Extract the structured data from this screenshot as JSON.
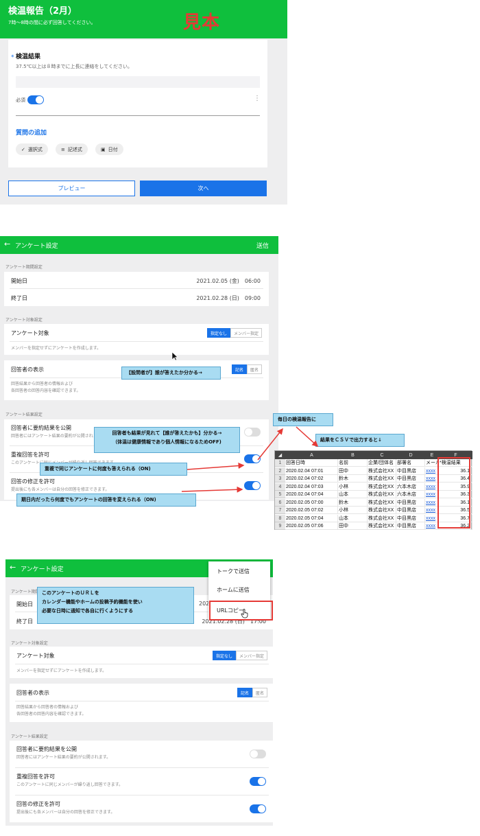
{
  "screen1": {
    "title": "検温報告（2月）",
    "subtitle": "7時～8時の間に必ず回答してください。",
    "sample_stamp": "見本",
    "question_required_mark": "*",
    "question_title": "検温結果",
    "question_desc": "37.5℃以上は８時までに上長に連絡をしてください。",
    "required_label": "必須",
    "more_icon": "⋮",
    "add_question": "質問の追加",
    "chips": [
      "選択式",
      "記述式",
      "日付"
    ],
    "preview_button": "プレビュー",
    "next_button": "次へ"
  },
  "screen2": {
    "title": "アンケート設定",
    "send": "送信",
    "period_section": "アンケート期間設定",
    "start_label": "開始日",
    "start_value": "2021.02.05 (金)　06:00",
    "end_label": "終了日",
    "end_value": "2021.02.28 (日)　09:00",
    "target_section": "アンケート対象設定",
    "target_label": "アンケート対象",
    "target_options": [
      "指定なし",
      "メンバー指定"
    ],
    "target_note": "メンバーを指定せずにアンケートを作成します。",
    "display_label": "回答者の表示",
    "display_options": [
      "記名",
      "匿名"
    ],
    "display_note_1": "回答結果から回答者の情報および",
    "display_note_2": "各回答者の回答内容を確認できます。",
    "result_section": "アンケート結果設定",
    "publish_label": "回答者に要約結果を公開",
    "publish_note": "回答者にはアンケート結果の要約が公開されます。",
    "dup_label": "重複回答を許可",
    "dup_note": "このアンケートに同じメンバーが繰り返し回答できます。",
    "edit_label": "回答の修正を許可",
    "edit_note": "提出後にも各メンバーは自分の回答を修正できます。"
  },
  "callouts": {
    "who_answered": "【設問者が】誰が答えたか分かる→",
    "results_visible_1": "回答者も結果が見れて【誰が答えたかも】分かる→",
    "results_visible_2": "（体温は健康情報であり個人情報になるためOFF)",
    "duplicate": "重複で同じアンケートに何度も答えられる（ON)",
    "edit": "期日内だったら何度でもアンケートの回答を変えられる（ON)",
    "daily": "毎日の検温報告に",
    "csv": "結果をＣＳＶで出力すると↓",
    "url_1": "このアンケートのＵＲＬを",
    "url_2": "カレンダー機能やホームの投稿予約機能を使い",
    "url_3": "必要な日時に通知で各自に行くようにする"
  },
  "spreadsheet": {
    "columns": [
      "A",
      "B",
      "C",
      "D",
      "E",
      "F"
    ],
    "header": [
      "回答日時",
      "名前",
      "企業/団体名",
      "部署名",
      "メール",
      "*検温結果"
    ],
    "rows": [
      [
        "2020.02.04 07:01",
        "田中",
        "株式会社XX",
        "中目黒店",
        "xxxx",
        "36.1"
      ],
      [
        "2020.02.04 07:02",
        "鈴木",
        "株式会社XX",
        "中目黒店",
        "xxxx",
        "36.4"
      ],
      [
        "2020.02.04 07:03",
        "小林",
        "株式会社XX",
        "六本木店",
        "xxxx",
        "35.9"
      ],
      [
        "2020.02.04 07:04",
        "山本",
        "株式会社XX",
        "六本木店",
        "xxxx",
        "36.3"
      ],
      [
        "2020.02.05 07:00",
        "鈴木",
        "株式会社XX",
        "中目黒店",
        "xxxx",
        "36.1"
      ],
      [
        "2020.02.05 07:02",
        "小林",
        "株式会社XX",
        "中目黒店",
        "xxxx",
        "36.5"
      ],
      [
        "2020.02.05 07:04",
        "山本",
        "株式会社XX",
        "中目黒店",
        "xxxx",
        "36.7"
      ],
      [
        "2020.02.05 07:06",
        "田中",
        "株式会社XX",
        "中目黒店",
        "xxxx",
        "36.2"
      ]
    ]
  },
  "screen3": {
    "title": "アンケート設定",
    "period_section": "アンケート期間設定",
    "start_label": "開始日",
    "start_value": "2021",
    "end_label": "終了日",
    "end_value": "2021.02.28 (日)　17:00",
    "menu": [
      "トークで送信",
      "ホームに送信",
      "URLコピー"
    ]
  }
}
